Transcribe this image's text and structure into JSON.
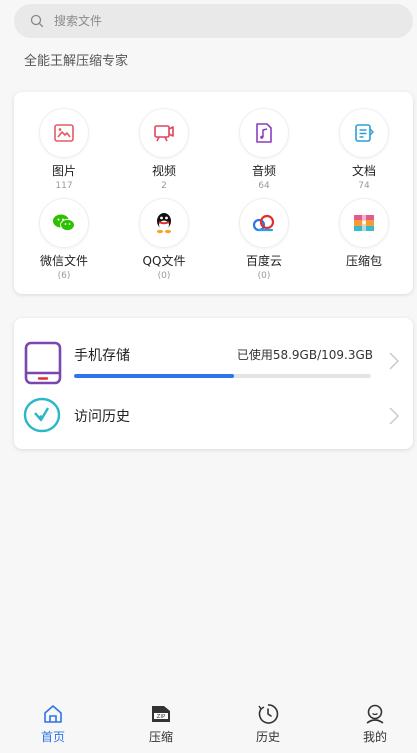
{
  "search": {
    "placeholder": "搜索文件"
  },
  "subtitle": "全能王解压缩专家",
  "categories": [
    {
      "label": "图片",
      "count": "117",
      "icon": "image-icon",
      "color": "#e45a63"
    },
    {
      "label": "视频",
      "count": "2",
      "icon": "video-icon",
      "color": "#e2445c"
    },
    {
      "label": "音频",
      "count": "64",
      "icon": "audio-icon",
      "color": "#8a3fbf"
    },
    {
      "label": "文档",
      "count": "74",
      "icon": "document-icon",
      "color": "#2a9fd8"
    },
    {
      "label": "微信文件",
      "count": "(6)",
      "icon": "wechat-icon",
      "color": "#2dc100"
    },
    {
      "label": "QQ文件",
      "count": "(0)",
      "icon": "qq-icon",
      "color": "#111111"
    },
    {
      "label": "百度云",
      "count": "(0)",
      "icon": "baidu-cloud-icon",
      "color": "#2f74e8"
    },
    {
      "label": "压缩包",
      "count": "",
      "icon": "archive-icon",
      "color": "#f39c3d"
    }
  ],
  "storage": {
    "title": "手机存储",
    "used_text": "已使用58.9GB/109.3GB",
    "used_fraction": 0.539,
    "icon": "phone-storage-icon",
    "bar_color": "#2f74e8"
  },
  "history": {
    "title": "访问历史",
    "icon": "clock-icon",
    "color": "#2ab7c9"
  },
  "tabs": [
    {
      "label": "首页",
      "icon": "home-icon",
      "active": true
    },
    {
      "label": "压缩",
      "icon": "zip-icon",
      "active": false
    },
    {
      "label": "历史",
      "icon": "history-icon",
      "active": false
    },
    {
      "label": "我的",
      "icon": "profile-icon",
      "active": false
    }
  ],
  "colors": {
    "accent": "#2f74e8",
    "background": "#f7f7f7"
  }
}
